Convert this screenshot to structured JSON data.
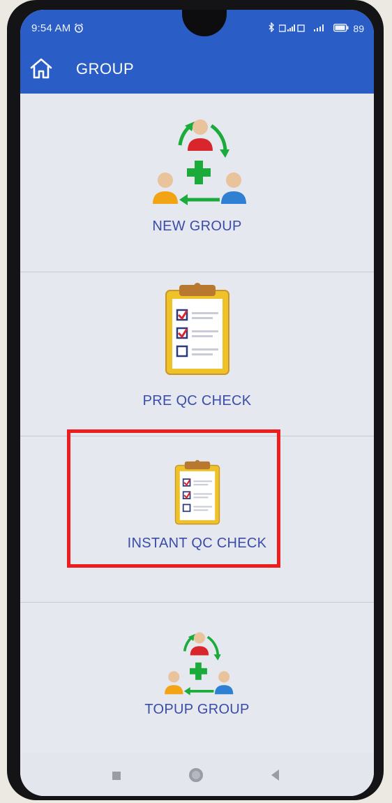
{
  "status_bar": {
    "time": "9:54 AM",
    "alarm_icon": "alarm-icon",
    "battery": "89"
  },
  "app_bar": {
    "title": "GROUP",
    "home_icon": "home-icon",
    "background": "#2a5ec6"
  },
  "menu": {
    "items": [
      {
        "label": "NEW GROUP",
        "icon": "group-add-icon"
      },
      {
        "label": "PRE QC CHECK",
        "icon": "clipboard-checklist-icon"
      },
      {
        "label": "INSTANT QC CHECK",
        "icon": "clipboard-checklist-icon"
      },
      {
        "label": "TOPUP GROUP",
        "icon": "group-add-icon"
      }
    ],
    "label_color": "#3a4ca8",
    "highlighted_item": "INSTANT QC CHECK",
    "highlight_color": "#ee1c1c"
  },
  "nav_bar": {
    "icons": [
      "recents-icon",
      "home-icon",
      "back-icon"
    ]
  }
}
